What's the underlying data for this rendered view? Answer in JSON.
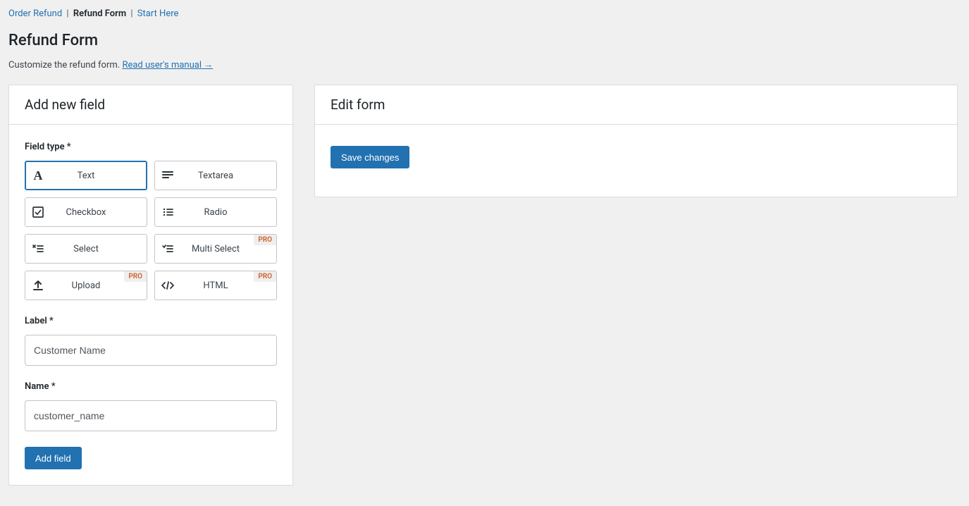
{
  "breadcrumb": {
    "items": [
      {
        "label": "Order Refund",
        "active": false
      },
      {
        "label": "Refund Form",
        "active": true
      },
      {
        "label": "Start Here",
        "active": false
      }
    ]
  },
  "page": {
    "title": "Refund Form",
    "subtitle_pre": "Customize the refund form. ",
    "manual_link": "Read user's manual →"
  },
  "add_panel": {
    "heading": "Add new field",
    "field_type_label": "Field type *",
    "label_label": "Label *",
    "name_label": "Name *",
    "label_value": "Customer Name",
    "name_value": "customer_name",
    "add_button": "Add field",
    "pro_badge": "PRO",
    "types": [
      {
        "key": "text",
        "label": "Text",
        "icon": "A",
        "pro": false,
        "selected": true
      },
      {
        "key": "textarea",
        "label": "Textarea",
        "icon": "textarea",
        "pro": false,
        "selected": false
      },
      {
        "key": "checkbox",
        "label": "Checkbox",
        "icon": "checkbox",
        "pro": false,
        "selected": false
      },
      {
        "key": "radio",
        "label": "Radio",
        "icon": "radio",
        "pro": false,
        "selected": false
      },
      {
        "key": "select",
        "label": "Select",
        "icon": "select",
        "pro": false,
        "selected": false
      },
      {
        "key": "multiselect",
        "label": "Multi Select",
        "icon": "multi",
        "pro": true,
        "selected": false
      },
      {
        "key": "upload",
        "label": "Upload",
        "icon": "upload",
        "pro": true,
        "selected": false
      },
      {
        "key": "html",
        "label": "HTML",
        "icon": "code",
        "pro": true,
        "selected": false
      }
    ]
  },
  "edit_panel": {
    "heading": "Edit form",
    "save_button": "Save changes"
  }
}
